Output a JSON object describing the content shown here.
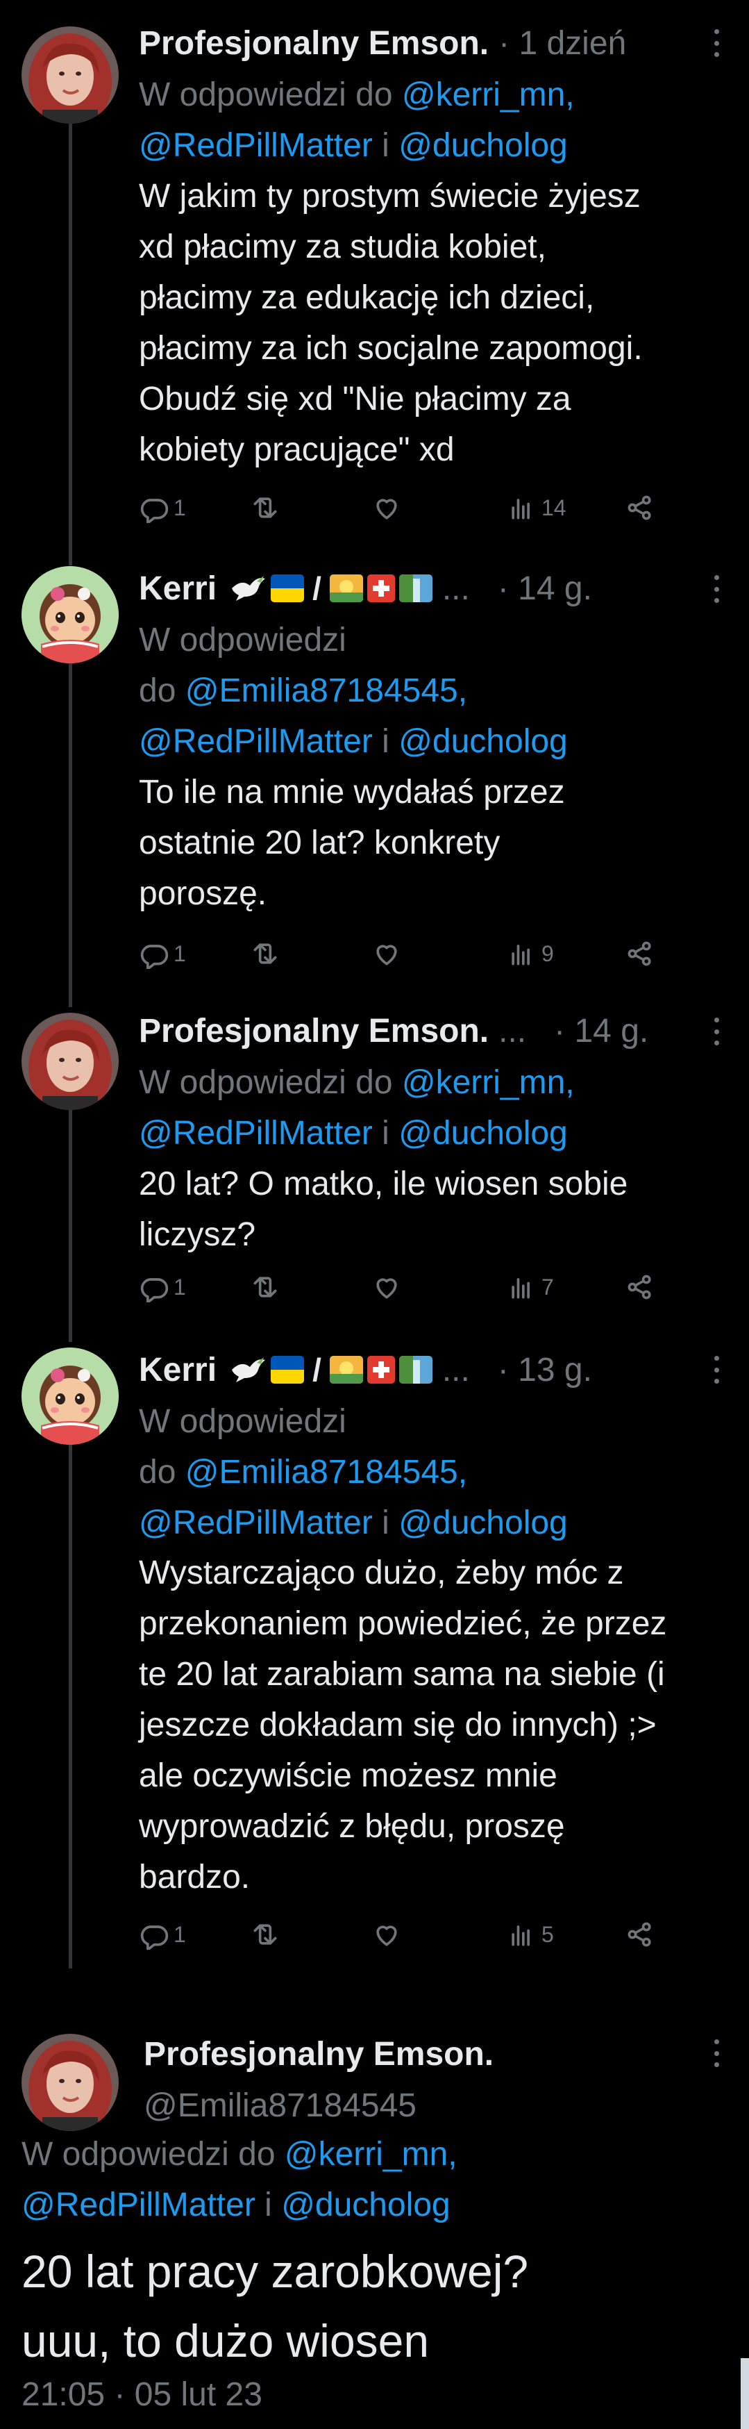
{
  "tweets": [
    {
      "name": "Profesjonalny Emson.",
      "time": "· 1 dzień",
      "reply_prefix": "W odpowiedzi do",
      "reply_mention1": "@kerri_mn,",
      "reply_mention2": "@RedPillMatter",
      "reply_and": "i",
      "reply_mention3": "@ducholog",
      "text": "W jakim ty prostym świecie żyjesz\nxd płacimy za studia kobiet,\npłacimy za edukację ich dzieci,\npłacimy za ich socjalne zapomogi.\nObudź się xd \"Nie płacimy za\nkobiety pracujące\" xd",
      "reply_count": "1",
      "views": "14"
    },
    {
      "name": "Kerri",
      "ellipsis": "...",
      "time": "· 14 g.",
      "reply_prefix": "W odpowiedzi",
      "reply_do": "do",
      "reply_mention1": "@Emilia87184545,",
      "reply_mention2": "@RedPillMatter",
      "reply_and": "i",
      "reply_mention3": "@ducholog",
      "text": "To ile na mnie wydałaś przez\nostatnie 20 lat? konkrety\nporoszę.",
      "reply_count": "1",
      "views": "9"
    },
    {
      "name": "Profesjonalny Emson.",
      "ellipsis": "...",
      "time": "· 14 g.",
      "reply_prefix": "W odpowiedzi do",
      "reply_mention1": "@kerri_mn,",
      "reply_mention2": "@RedPillMatter",
      "reply_and": "i",
      "reply_mention3": "@ducholog",
      "text": "20 lat? O matko, ile wiosen sobie\nliczysz?",
      "reply_count": "1",
      "views": "7"
    },
    {
      "name": "Kerri",
      "ellipsis": "...",
      "time": "· 13 g.",
      "reply_prefix": "W odpowiedzi",
      "reply_do": "do",
      "reply_mention1": "@Emilia87184545,",
      "reply_mention2": "@RedPillMatter",
      "reply_and": "i",
      "reply_mention3": "@ducholog",
      "text": "Wystarczająco dużo, żeby móc z\nprzekonaniem powiedzieć, że przez\nte 20 lat zarabiam sama na siebie (i\njeszcze dokładam się do innych) ;>\nale oczywiście możesz mnie\nwyprowadzić z błędu, proszę\nbardzo.",
      "reply_count": "1",
      "views": "5"
    }
  ],
  "main": {
    "name": "Profesjonalny Emson.",
    "handle": "@Emilia87184545",
    "reply_prefix": "W odpowiedzi do",
    "reply_mention1": "@kerri_mn,",
    "reply_mention2": "@RedPillMatter",
    "reply_and": "i",
    "reply_mention3": "@ducholog",
    "text_line1": "20 lat pracy zarobkowej?",
    "text_line2": "uuu, to dużo wiosen",
    "timestamp": "21:05 · 05 lut 23"
  },
  "icons": {
    "reply": "reply-icon",
    "retweet": "retweet-icon",
    "like": "heart-icon",
    "views": "views-icon",
    "share": "share-icon",
    "more": "more-icon"
  },
  "colors": {
    "background": "#000000",
    "text": "#e7e9ea",
    "muted": "#71767b",
    "link": "#1d9bf0",
    "thread_line": "#333639"
  }
}
